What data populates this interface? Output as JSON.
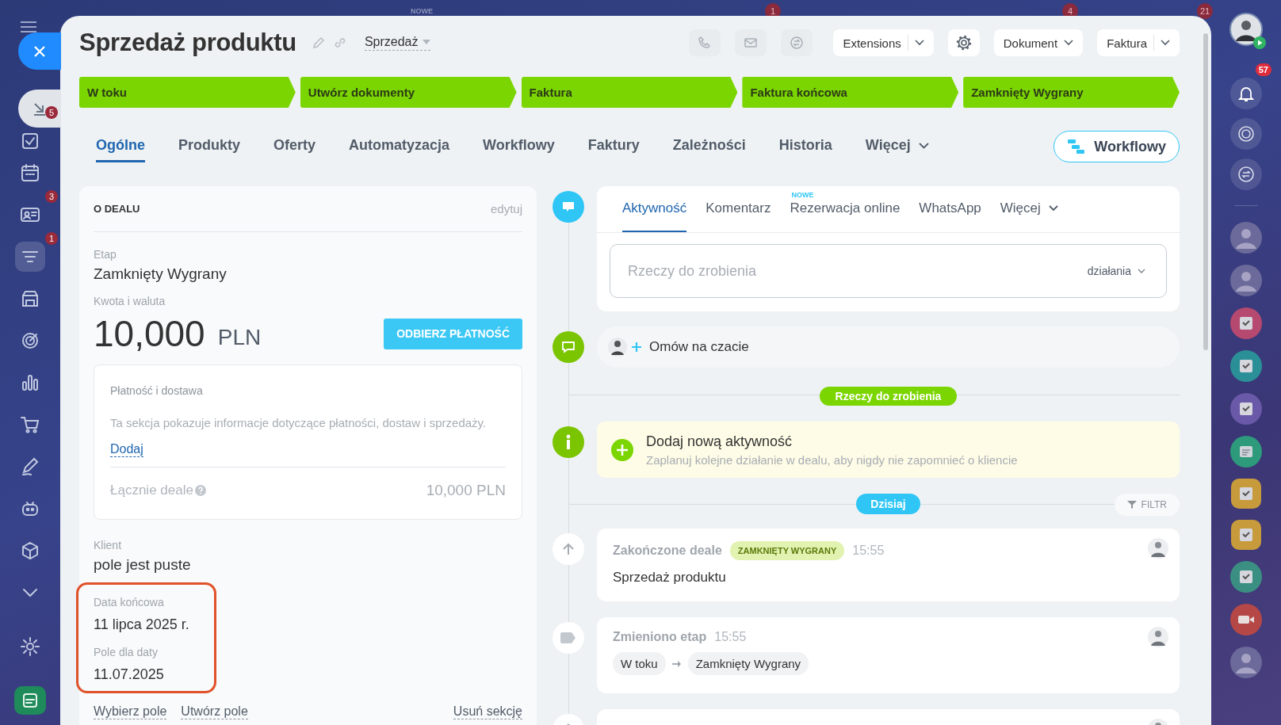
{
  "backdrop": {
    "new_label": "NOWE",
    "badges": [
      "1",
      "4",
      "21"
    ]
  },
  "left_nav": {
    "items": [
      {
        "selected": false,
        "badge": "5"
      },
      {
        "selected": false
      },
      {
        "selected": false,
        "badge": "3"
      },
      {
        "selected": true,
        "badge": "1"
      },
      {
        "selected": false
      },
      {
        "selected": false
      },
      {
        "selected": false
      },
      {
        "selected": false
      },
      {
        "selected": false
      },
      {
        "selected": false
      },
      {
        "selected": false
      },
      {
        "selected": false
      },
      {
        "selected": false
      },
      {
        "selected": false
      }
    ]
  },
  "header": {
    "title": "Sprzedaż produktu",
    "category": "Sprzedaż",
    "comm_buttons": [
      {
        "disabled": true
      },
      {
        "disabled": true
      },
      {
        "disabled": true
      }
    ],
    "toolbar": [
      {
        "kind": "split",
        "label": "Extensions"
      },
      {
        "kind": "gear"
      },
      {
        "kind": "dropdown",
        "label": "Dokument"
      },
      {
        "kind": "split",
        "label": "Faktura"
      }
    ]
  },
  "stages": [
    {
      "label": "W toku",
      "reached": true
    },
    {
      "label": "Utwórz dokumenty",
      "reached": true
    },
    {
      "label": "Faktura",
      "reached": true
    },
    {
      "label": "Faktura końcowa",
      "reached": true
    },
    {
      "label": "Zamknięty Wygrany",
      "reached": true
    }
  ],
  "tabs": [
    {
      "label": "Ogólne",
      "selected": true,
      "kind": "tab"
    },
    {
      "label": "Produkty",
      "selected": false,
      "kind": "tab"
    },
    {
      "label": "Oferty",
      "selected": false,
      "kind": "tab"
    },
    {
      "label": "Automatyzacja",
      "selected": false,
      "kind": "tab"
    },
    {
      "label": "Workflowy",
      "selected": false,
      "kind": "tab"
    },
    {
      "label": "Faktury",
      "selected": false,
      "kind": "tab"
    },
    {
      "label": "Zależności",
      "selected": false,
      "kind": "tab"
    },
    {
      "label": "Historia",
      "selected": false,
      "kind": "tab"
    },
    {
      "label": "Więcej",
      "selected": false,
      "kind": "menu"
    }
  ],
  "workflow_button": "Workflowy",
  "deal_card": {
    "heading": "O DEALU",
    "edit": "edytuj",
    "stage_label": "Etap",
    "stage_value": "Zamknięty Wygrany",
    "amount_label": "Kwota i waluta",
    "amount": "10,000",
    "currency": "PLN",
    "pay_button": "ODBIERZ PŁATNOŚĆ",
    "payment": {
      "title": "Płatność i dostawa",
      "text": "Ta sekcja pokazuje informacje dotyczące płatności, dostaw i sprzedaży.",
      "add": "Dodaj",
      "total_label": "Łącznie deale",
      "total_value": "10,000 PLN"
    },
    "fields": [
      {
        "label": "Klient",
        "value": "pole jest puste",
        "highlighted": false
      },
      {
        "label": "Data końcowa",
        "value": "11 lipca 2025 r.",
        "highlighted": true
      },
      {
        "label": "Pole dla daty",
        "value": "11.07.2025",
        "highlighted": true
      }
    ],
    "links": [
      "Wybierz pole",
      "Utwórz pole"
    ],
    "remove_link": "Usuń sekcję"
  },
  "timeline": {
    "activity_tabs": [
      {
        "label": "Aktywność",
        "selected": true,
        "kind": "tab"
      },
      {
        "label": "Komentarz",
        "selected": false,
        "kind": "tab"
      },
      {
        "label": "Rezerwacja online",
        "selected": false,
        "kind": "tab",
        "badge": "NOWE"
      },
      {
        "label": "WhatsApp",
        "selected": false,
        "kind": "tab"
      },
      {
        "label": "Więcej",
        "selected": false,
        "kind": "menu"
      }
    ],
    "todo_placeholder": "Rzeczy do zrobienia",
    "todo_menu": "działania",
    "chat_prompt": "Omów na czacie",
    "todo_divider": "Rzeczy do zrobienia",
    "add_activity": {
      "title": "Dodaj nową aktywność",
      "text": "Zaplanuj kolejne działanie w dealu, aby nigdy nie zapomnieć o kliencie"
    },
    "today": "Dzisiaj",
    "filter": "FILTR",
    "events": [
      {
        "kind": "closed",
        "title": "Zakończone deale",
        "tag": "ZAMKNIĘTY WYGRANY",
        "time": "15:55",
        "text": "Sprzedaż produktu"
      },
      {
        "kind": "stage",
        "title": "Zmieniono etap",
        "time": "15:55",
        "from": "W toku",
        "to": "Zamknięty Wygrany"
      },
      {
        "kind": "created"
      }
    ]
  },
  "right_rail": {
    "notifications": "57",
    "chats": [
      {
        "kind": "avatar"
      },
      {
        "kind": "avatar"
      },
      {
        "kind": "task",
        "color": "#b5496f"
      },
      {
        "kind": "task",
        "color": "#2b8f97"
      },
      {
        "kind": "task",
        "color": "#6a58a8"
      },
      {
        "kind": "news",
        "color": "#2e9a7c"
      },
      {
        "kind": "task",
        "color": "#c79a3c"
      },
      {
        "kind": "task",
        "color": "#c79a3c"
      },
      {
        "kind": "task",
        "color": "#3b8f82"
      },
      {
        "kind": "video",
        "color": "#b54846"
      },
      {
        "kind": "avatar"
      }
    ]
  }
}
